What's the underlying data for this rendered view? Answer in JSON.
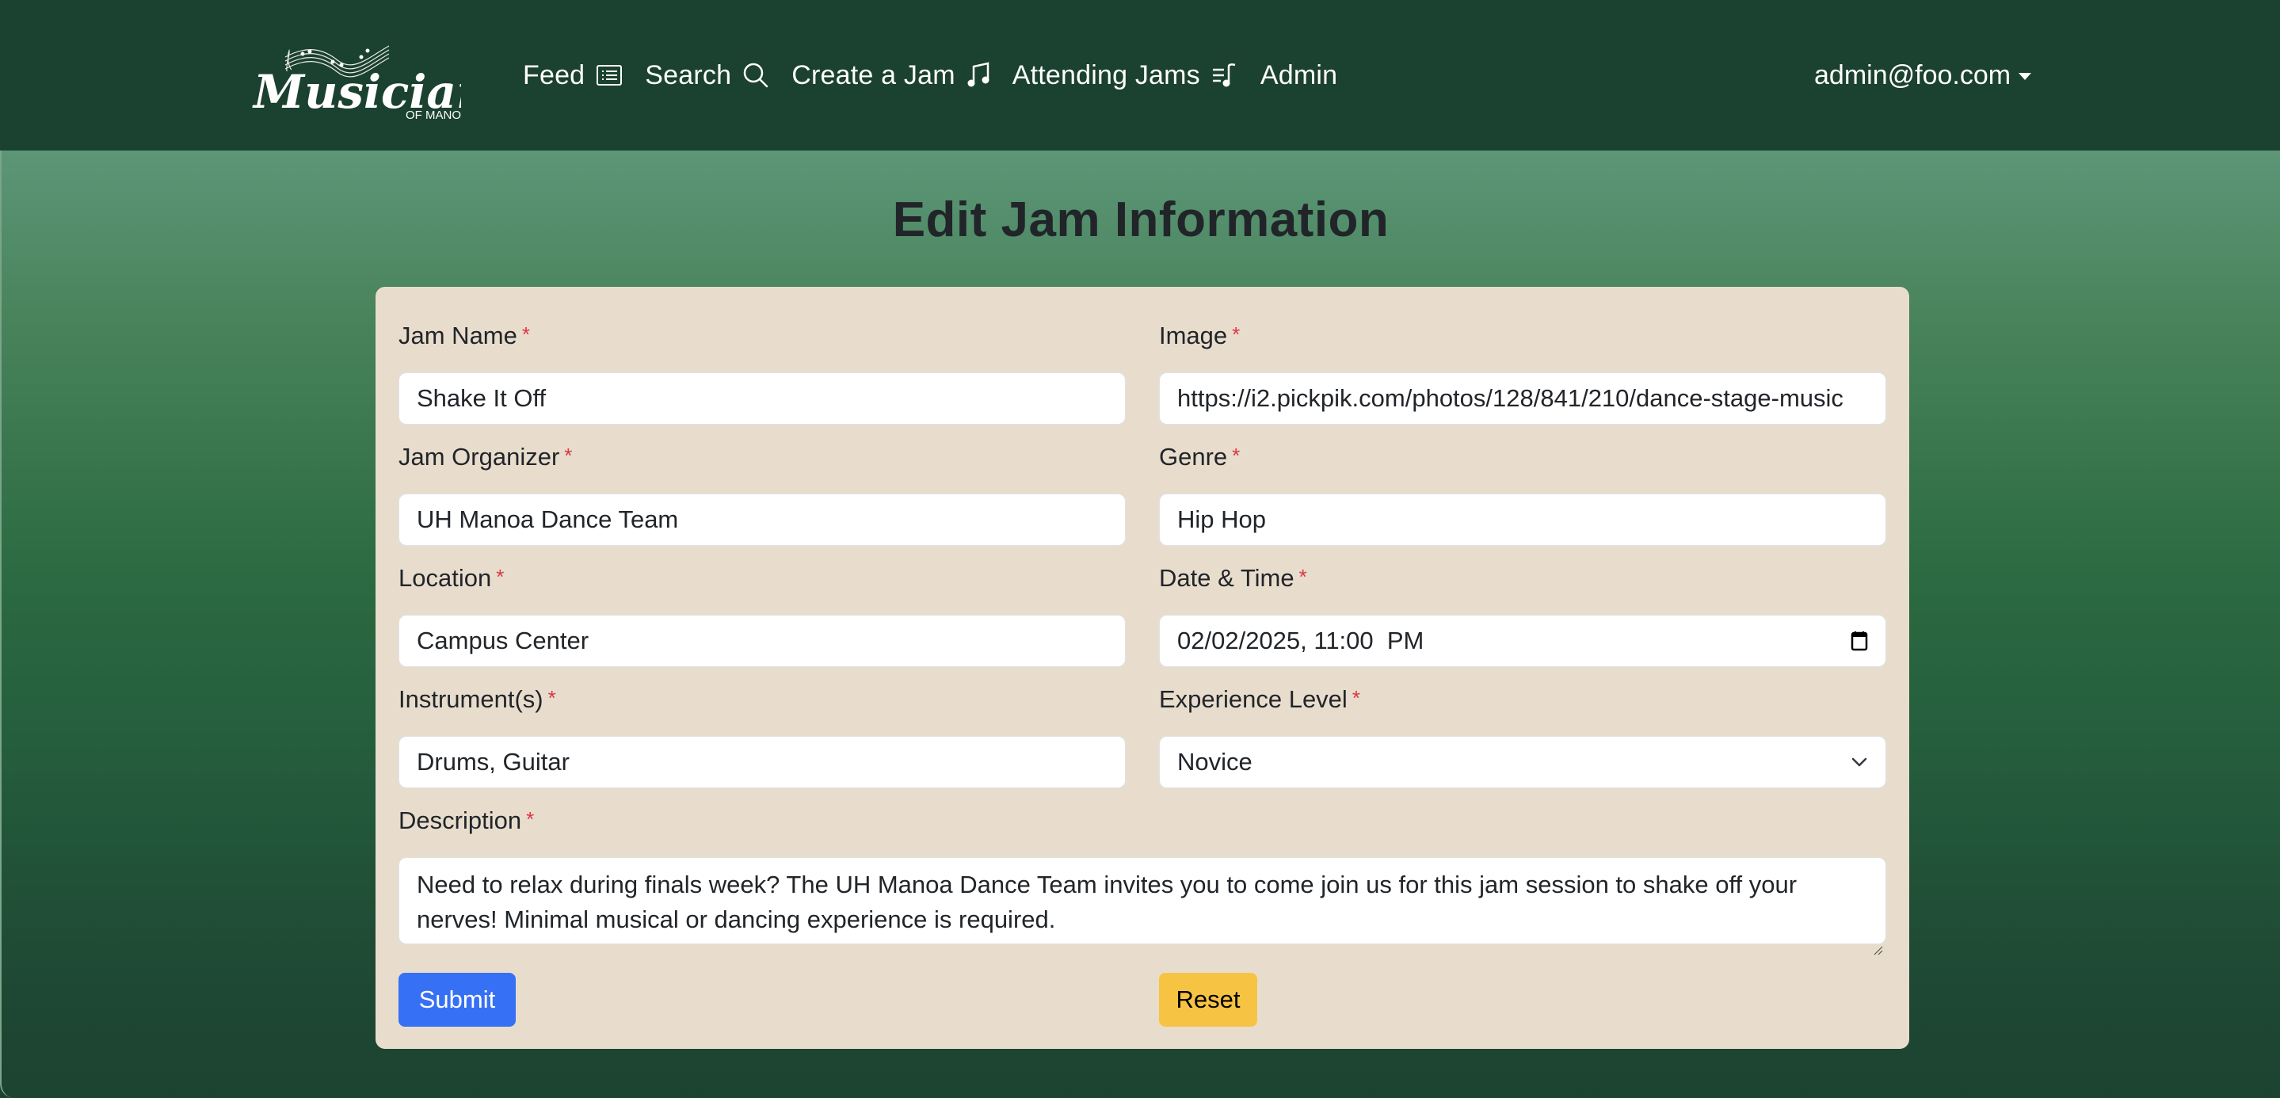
{
  "brand": {
    "name": "Musicians",
    "subtitle": "OF MANOA",
    "icon": "music-staff-icon"
  },
  "nav": {
    "items": [
      {
        "label": "Feed",
        "icon": "list-icon"
      },
      {
        "label": "Search",
        "icon": "search-icon"
      },
      {
        "label": "Create a Jam",
        "icon": "music-note-icon"
      },
      {
        "label": "Attending Jams",
        "icon": "music-playlist-icon"
      },
      {
        "label": "Admin",
        "icon": ""
      }
    ],
    "user": {
      "email": "admin@foo.com",
      "icon": "caret-down-icon"
    }
  },
  "page": {
    "title": "Edit Jam Information"
  },
  "form": {
    "required_marker": "*",
    "fields": {
      "jam_name": {
        "label": "Jam Name",
        "value": "Shake It Off"
      },
      "image": {
        "label": "Image",
        "value": "https://i2.pickpik.com/photos/128/841/210/dance-stage-music"
      },
      "organizer": {
        "label": "Jam Organizer",
        "value": "UH Manoa Dance Team"
      },
      "genre": {
        "label": "Genre",
        "value": "Hip Hop"
      },
      "location": {
        "label": "Location",
        "value": "Campus Center"
      },
      "date_time": {
        "label": "Date & Time",
        "value": "02/02/2025, 11:00  PM",
        "icon": "calendar-icon"
      },
      "instruments": {
        "label": "Instrument(s)",
        "value": "Drums, Guitar"
      },
      "experience": {
        "label": "Experience Level",
        "value": "Novice",
        "icon": "chevron-down-icon"
      },
      "description": {
        "label": "Description",
        "value": "Need to relax during finals week? The UH Manoa Dance Team invites you to come join us for this jam session to shake off your nerves! Minimal musical or dancing experience is required."
      }
    },
    "submit_label": "Submit",
    "reset_label": "Reset"
  },
  "colors": {
    "navbar": "#1b4130",
    "card": "#e8ddcd",
    "submit": "#3670f5",
    "reset": "#f6c343",
    "required": "#dc3545"
  }
}
